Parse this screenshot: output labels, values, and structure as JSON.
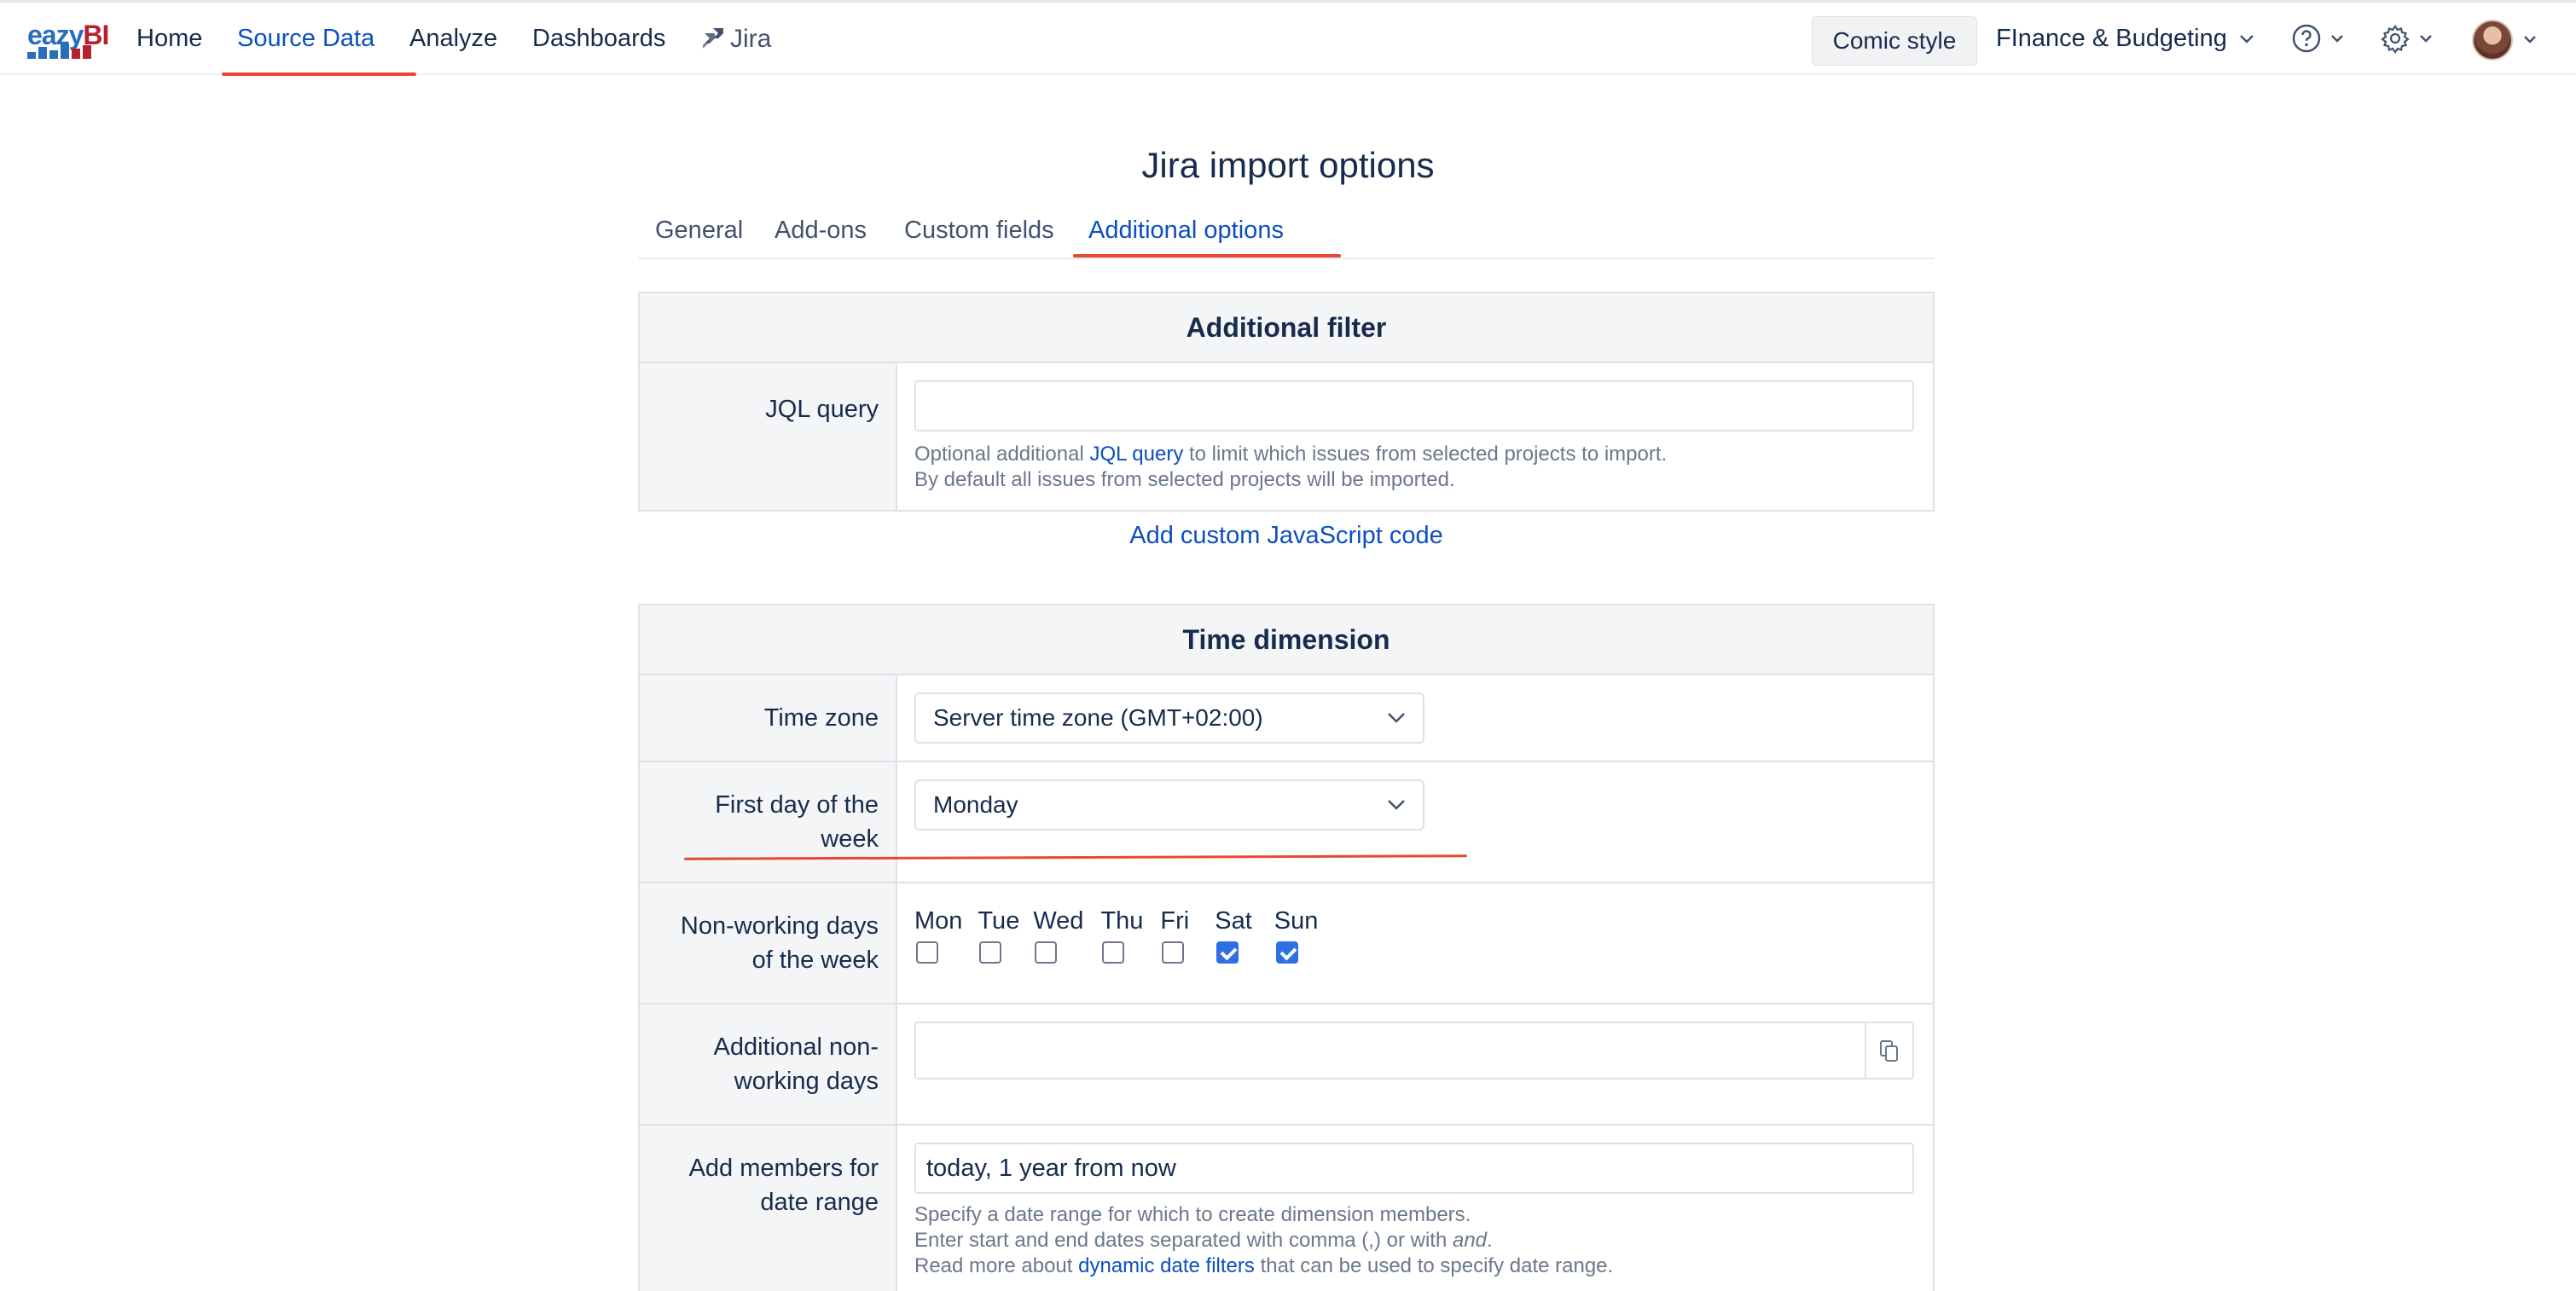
{
  "brand": {
    "logo_text_e": "ea",
    "logo_text_z": "zy",
    "logo_text_bi": "BI"
  },
  "nav": {
    "home": "Home",
    "source_data": "Source Data",
    "analyze": "Analyze",
    "dashboards": "Dashboards",
    "jira": "Jira",
    "comic_style": "Comic style",
    "account": "FInance & Budgeting"
  },
  "page": {
    "title": "Jira import options"
  },
  "tabs": [
    "General",
    "Add-ons",
    "Custom fields",
    "Additional options"
  ],
  "additional_filter": {
    "title": "Additional filter",
    "jql_label": "JQL query",
    "jql_value": "",
    "help_prefix": "Optional additional",
    "help_link": "JQL query",
    "help_suffix": "to limit which issues from selected projects to import.",
    "help_line2": "By default all issues from selected projects will be imported.",
    "custom_js_link": "Add custom JavaScript code"
  },
  "time_dimension": {
    "title": "Time dimension",
    "time_zone_label": "Time zone",
    "time_zone_value": "Server time zone (GMT+02:00)",
    "first_day_label": "First day of the week",
    "first_day_value": "Monday",
    "nonworking_label": "Non-working days of the week",
    "days": [
      {
        "label": "Mon",
        "checked": false
      },
      {
        "label": "Tue",
        "checked": false
      },
      {
        "label": "Wed",
        "checked": false
      },
      {
        "label": "Thu",
        "checked": false
      },
      {
        "label": "Fri",
        "checked": false
      },
      {
        "label": "Sat",
        "checked": true
      },
      {
        "label": "Sun",
        "checked": true
      }
    ],
    "additional_nonworking_label": "Additional non-working days",
    "additional_nonworking_value": "",
    "date_range_label": "Add members for date range",
    "date_range_value": "today, 1 year from now",
    "date_help_line1": "Specify a date range for which to create dimension members.",
    "date_help_line2_prefix": "Enter start and end dates separated with comma (,) or with",
    "date_help_line2_em": "and",
    "date_help_line2_suffix": ".",
    "date_help_line3_prefix": "Read more about",
    "date_help_link": "dynamic date filters",
    "date_help_line3_suffix": "that can be used to specify date range."
  },
  "colors": {
    "accent": "#0c4fc0",
    "annotation": "#e64a2e",
    "checkbox": "#2f6fe4"
  },
  "icons": [
    "jira-icon",
    "chevron-down-icon",
    "help-icon",
    "gear-icon",
    "avatar",
    "copy-icon"
  ]
}
